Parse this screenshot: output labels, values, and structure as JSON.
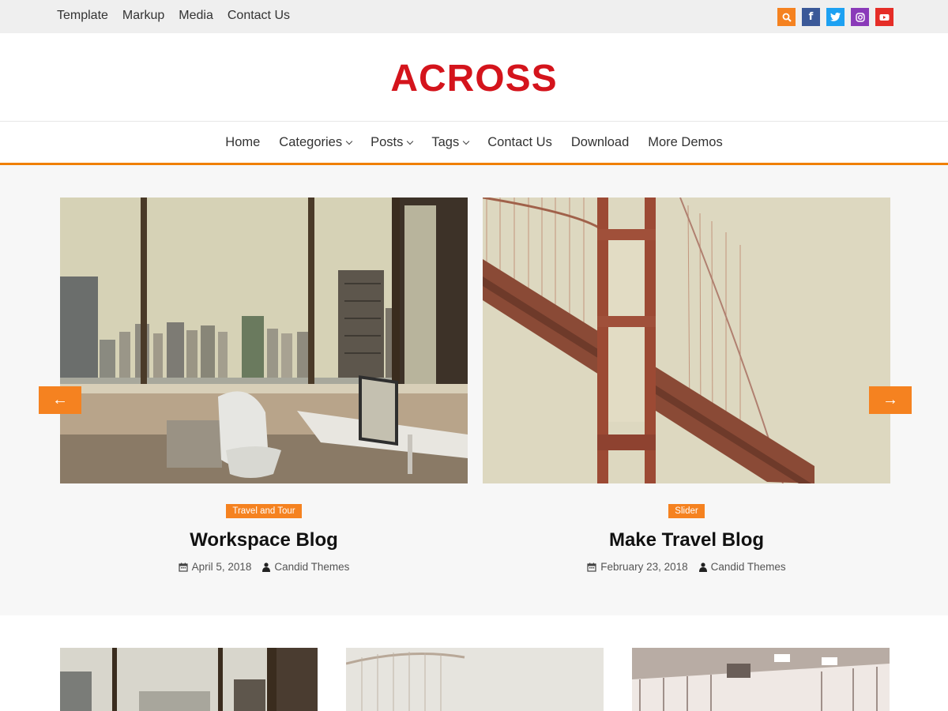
{
  "topbar": {
    "links": [
      "Template",
      "Markup",
      "Media",
      "Contact Us"
    ]
  },
  "social": [
    {
      "icon": "search-icon",
      "glyph": "⌕",
      "color": "#f58220"
    },
    {
      "icon": "facebook-icon",
      "glyph": "f",
      "color": "#3b5998"
    },
    {
      "icon": "twitter-icon",
      "glyph": "t",
      "color": "#1da1f2"
    },
    {
      "icon": "instagram-icon",
      "glyph": "◎",
      "color": "#8a3ab9"
    },
    {
      "icon": "youtube-icon",
      "glyph": "▶",
      "color": "#e52d27"
    }
  ],
  "site": {
    "title": "ACROSS",
    "title_color": "#d4141c"
  },
  "nav": {
    "items": [
      {
        "label": "Home",
        "dropdown": false
      },
      {
        "label": "Categories",
        "dropdown": true
      },
      {
        "label": "Posts",
        "dropdown": true
      },
      {
        "label": "Tags",
        "dropdown": true
      },
      {
        "label": "Contact Us",
        "dropdown": false
      },
      {
        "label": "Download",
        "dropdown": false
      },
      {
        "label": "More Demos",
        "dropdown": false
      }
    ]
  },
  "accent": "#f58220",
  "slides": [
    {
      "category": "Travel and Tour",
      "title": "Workspace Blog",
      "date": "April 5, 2018",
      "author": "Candid Themes"
    },
    {
      "category": "Slider",
      "title": "Make Travel Blog",
      "date": "February 23, 2018",
      "author": "Candid Themes"
    }
  ],
  "arrows": {
    "prev": "←",
    "next": "→"
  }
}
